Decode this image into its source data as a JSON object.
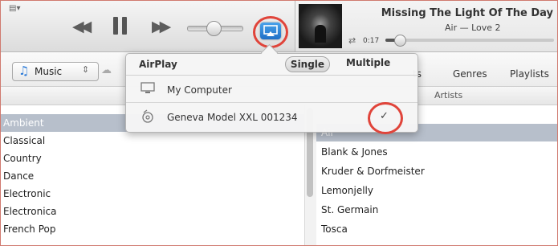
{
  "toolbar": {
    "window_menu_icon": "window-menu-icon",
    "controls": {
      "rewind_icon": "rewind-icon",
      "pause_icon": "pause-icon",
      "fast_forward_icon": "fast-forward-icon",
      "volume_level": 0.45,
      "airplay_icon": "airplay-icon"
    },
    "now_playing": {
      "song": "Missing The Light Of The Day",
      "artist_album": "Air — Love 2",
      "elapsed": "0:17",
      "progress": 0.08,
      "repeat_icon": "repeat-icon"
    }
  },
  "navbar": {
    "media_kind": "Music",
    "tabs": {
      "albums": "ts",
      "genres": "Genres",
      "playlists": "Playlists"
    }
  },
  "browser": {
    "artists_header": "Artists",
    "genres": [
      "Ambient",
      "Classical",
      "Country",
      "Dance",
      "Electronic",
      "Electronica",
      "French Pop"
    ],
    "selected_genre": "Ambient",
    "artists": [
      "Air",
      "Blank & Jones",
      "Kruder & Dorfmeister",
      "Lemonjelly",
      "St. Germain",
      "Tosca"
    ],
    "selected_artist": "Air"
  },
  "airplay_popover": {
    "title": "AirPlay",
    "modes": {
      "single": "Single",
      "multiple": "Multiple"
    },
    "active_mode": "Single",
    "devices": [
      {
        "name": "My Computer",
        "icon": "computer-icon",
        "selected": false
      },
      {
        "name": "Geneva Model XXL 001234",
        "icon": "speaker-icon",
        "selected": true
      }
    ],
    "check_icon": "checkmark-icon"
  },
  "colors": {
    "highlight_ring": "#e0443a",
    "airplay_blue": "#2f86db",
    "selection": "#b7bfcb"
  }
}
